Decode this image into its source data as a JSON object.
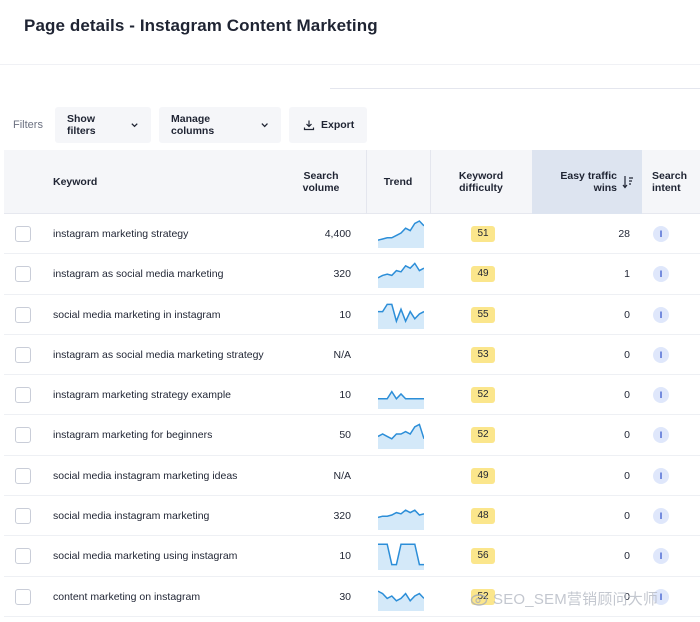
{
  "page": {
    "title": "Page details - Instagram Content Marketing"
  },
  "filters": {
    "label": "Filters",
    "show_filters": "Show filters",
    "manage_columns": "Manage columns",
    "export": "Export"
  },
  "columns": {
    "keyword": "Keyword",
    "search_volume": "Search volume",
    "trend": "Trend",
    "keyword_difficulty": "Keyword difficulty",
    "easy_traffic_wins": "Easy traffic wins",
    "search_intent": "Search intent"
  },
  "rows": [
    {
      "keyword": "instagram marketing strategy",
      "volume": "4,400",
      "kd": "51",
      "etw": "28",
      "intent": "I",
      "trend": [
        0.2,
        0.25,
        0.3,
        0.3,
        0.4,
        0.5,
        0.7,
        0.6,
        0.9,
        1.0,
        0.8
      ]
    },
    {
      "keyword": "instagram as social media marketing",
      "volume": "320",
      "kd": "49",
      "etw": "1",
      "intent": "I",
      "trend": [
        0.3,
        0.4,
        0.45,
        0.4,
        0.6,
        0.55,
        0.8,
        0.7,
        0.9,
        0.6,
        0.7
      ]
    },
    {
      "keyword": "social media marketing in instagram",
      "volume": "10",
      "kd": "55",
      "etw": "0",
      "intent": "I",
      "trend": [
        0.6,
        0.6,
        0.9,
        0.9,
        0.2,
        0.7,
        0.2,
        0.6,
        0.3,
        0.5,
        0.6
      ]
    },
    {
      "keyword": "instagram as social media marketing strategy",
      "volume": "N/A",
      "kd": "53",
      "etw": "0",
      "intent": "I",
      "trend": []
    },
    {
      "keyword": "instagram marketing strategy example",
      "volume": "10",
      "kd": "52",
      "etw": "0",
      "intent": "I",
      "trend": [
        0.3,
        0.3,
        0.3,
        0.6,
        0.3,
        0.5,
        0.3,
        0.3,
        0.3,
        0.3,
        0.3
      ]
    },
    {
      "keyword": "instagram marketing for beginners",
      "volume": "50",
      "kd": "52",
      "etw": "0",
      "intent": "I",
      "trend": [
        0.4,
        0.5,
        0.4,
        0.3,
        0.5,
        0.5,
        0.6,
        0.5,
        0.8,
        0.9,
        0.3
      ]
    },
    {
      "keyword": "social media instagram marketing ideas",
      "volume": "N/A",
      "kd": "49",
      "etw": "0",
      "intent": "I",
      "trend": []
    },
    {
      "keyword": "social media instagram marketing",
      "volume": "320",
      "kd": "48",
      "etw": "0",
      "intent": "I",
      "trend": [
        0.4,
        0.45,
        0.45,
        0.5,
        0.6,
        0.55,
        0.7,
        0.6,
        0.7,
        0.5,
        0.55
      ]
    },
    {
      "keyword": "social media marketing using instagram",
      "volume": "10",
      "kd": "56",
      "etw": "0",
      "intent": "I",
      "trend": [
        0.95,
        0.95,
        0.95,
        0.1,
        0.1,
        0.95,
        0.95,
        0.95,
        0.95,
        0.1,
        0.1
      ]
    },
    {
      "keyword": "content marketing on instagram",
      "volume": "30",
      "kd": "52",
      "etw": "0",
      "intent": "I",
      "trend": [
        0.7,
        0.6,
        0.4,
        0.5,
        0.3,
        0.4,
        0.6,
        0.3,
        0.5,
        0.6,
        0.4
      ]
    }
  ],
  "watermark": "SEO_SEM营销顾问大师",
  "colors": {
    "trend_line": "#2c8ed8",
    "trend_fill": "#d4e9f9",
    "kd_badge": "#fbe68c",
    "intent_badge": "#dfe7fb",
    "sorted_header": "#dde4f0"
  }
}
